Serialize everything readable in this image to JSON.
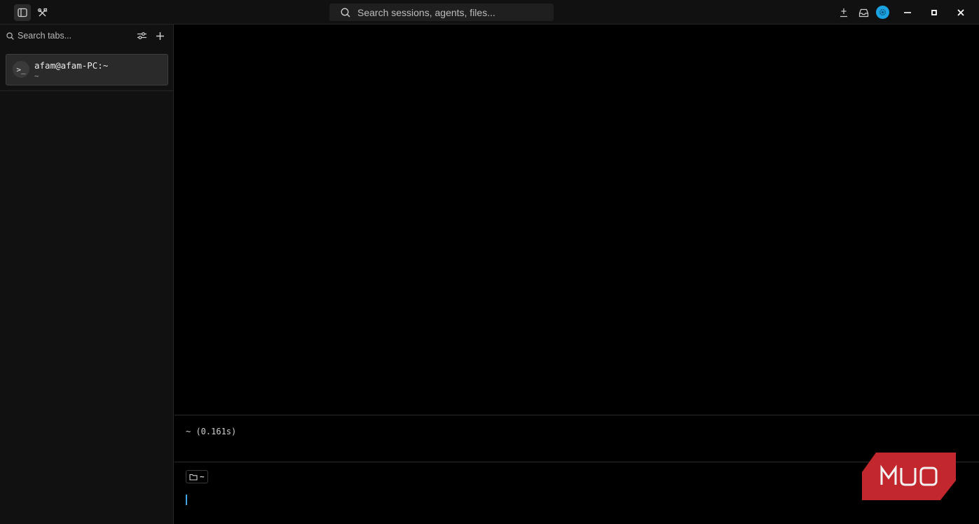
{
  "titlebar": {
    "search_placeholder": "Search sessions, agents, files...",
    "icons": [
      "sidebar-toggle-icon",
      "tools-icon",
      "search-icon",
      "download-icon",
      "inbox-icon",
      "settings-icon",
      "minimize-icon",
      "maximize-icon",
      "close-icon"
    ]
  },
  "sidebar": {
    "search_placeholder": "Search tabs...",
    "tabs": [
      {
        "title": "afam@afam-PC:~",
        "subtitle": "~",
        "icon": ">_"
      }
    ]
  },
  "terminal": {
    "block_output": "~ (0.161s)",
    "current_dir": "~"
  },
  "colors": {
    "accent": "#1aa3e0",
    "cursor": "#3ea6e6",
    "watermark": "#c1272d"
  }
}
